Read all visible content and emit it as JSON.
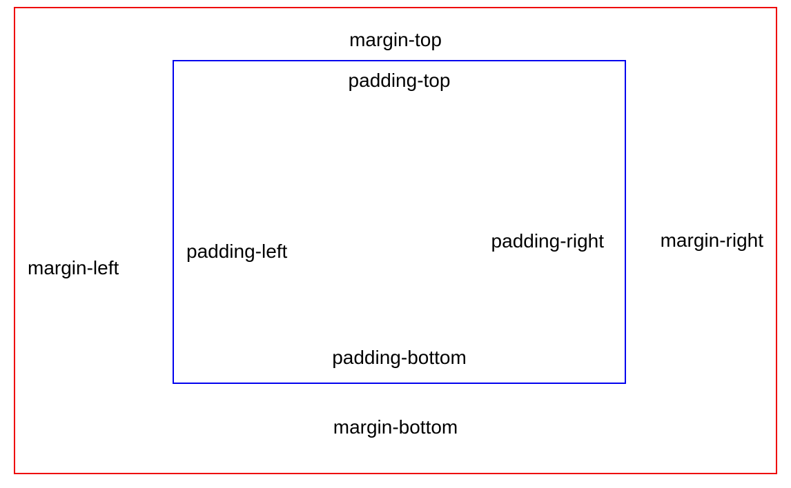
{
  "labels": {
    "marginTop": "margin-top",
    "marginBottom": "margin-bottom",
    "marginLeft": "margin-left",
    "marginRight": "margin-right",
    "paddingTop": "padding-top",
    "paddingBottom": "padding-bottom",
    "paddingLeft": "padding-left",
    "paddingRight": "padding-right"
  },
  "colors": {
    "outerBorder": "#ee0000",
    "innerBorder": "#0000ee"
  }
}
